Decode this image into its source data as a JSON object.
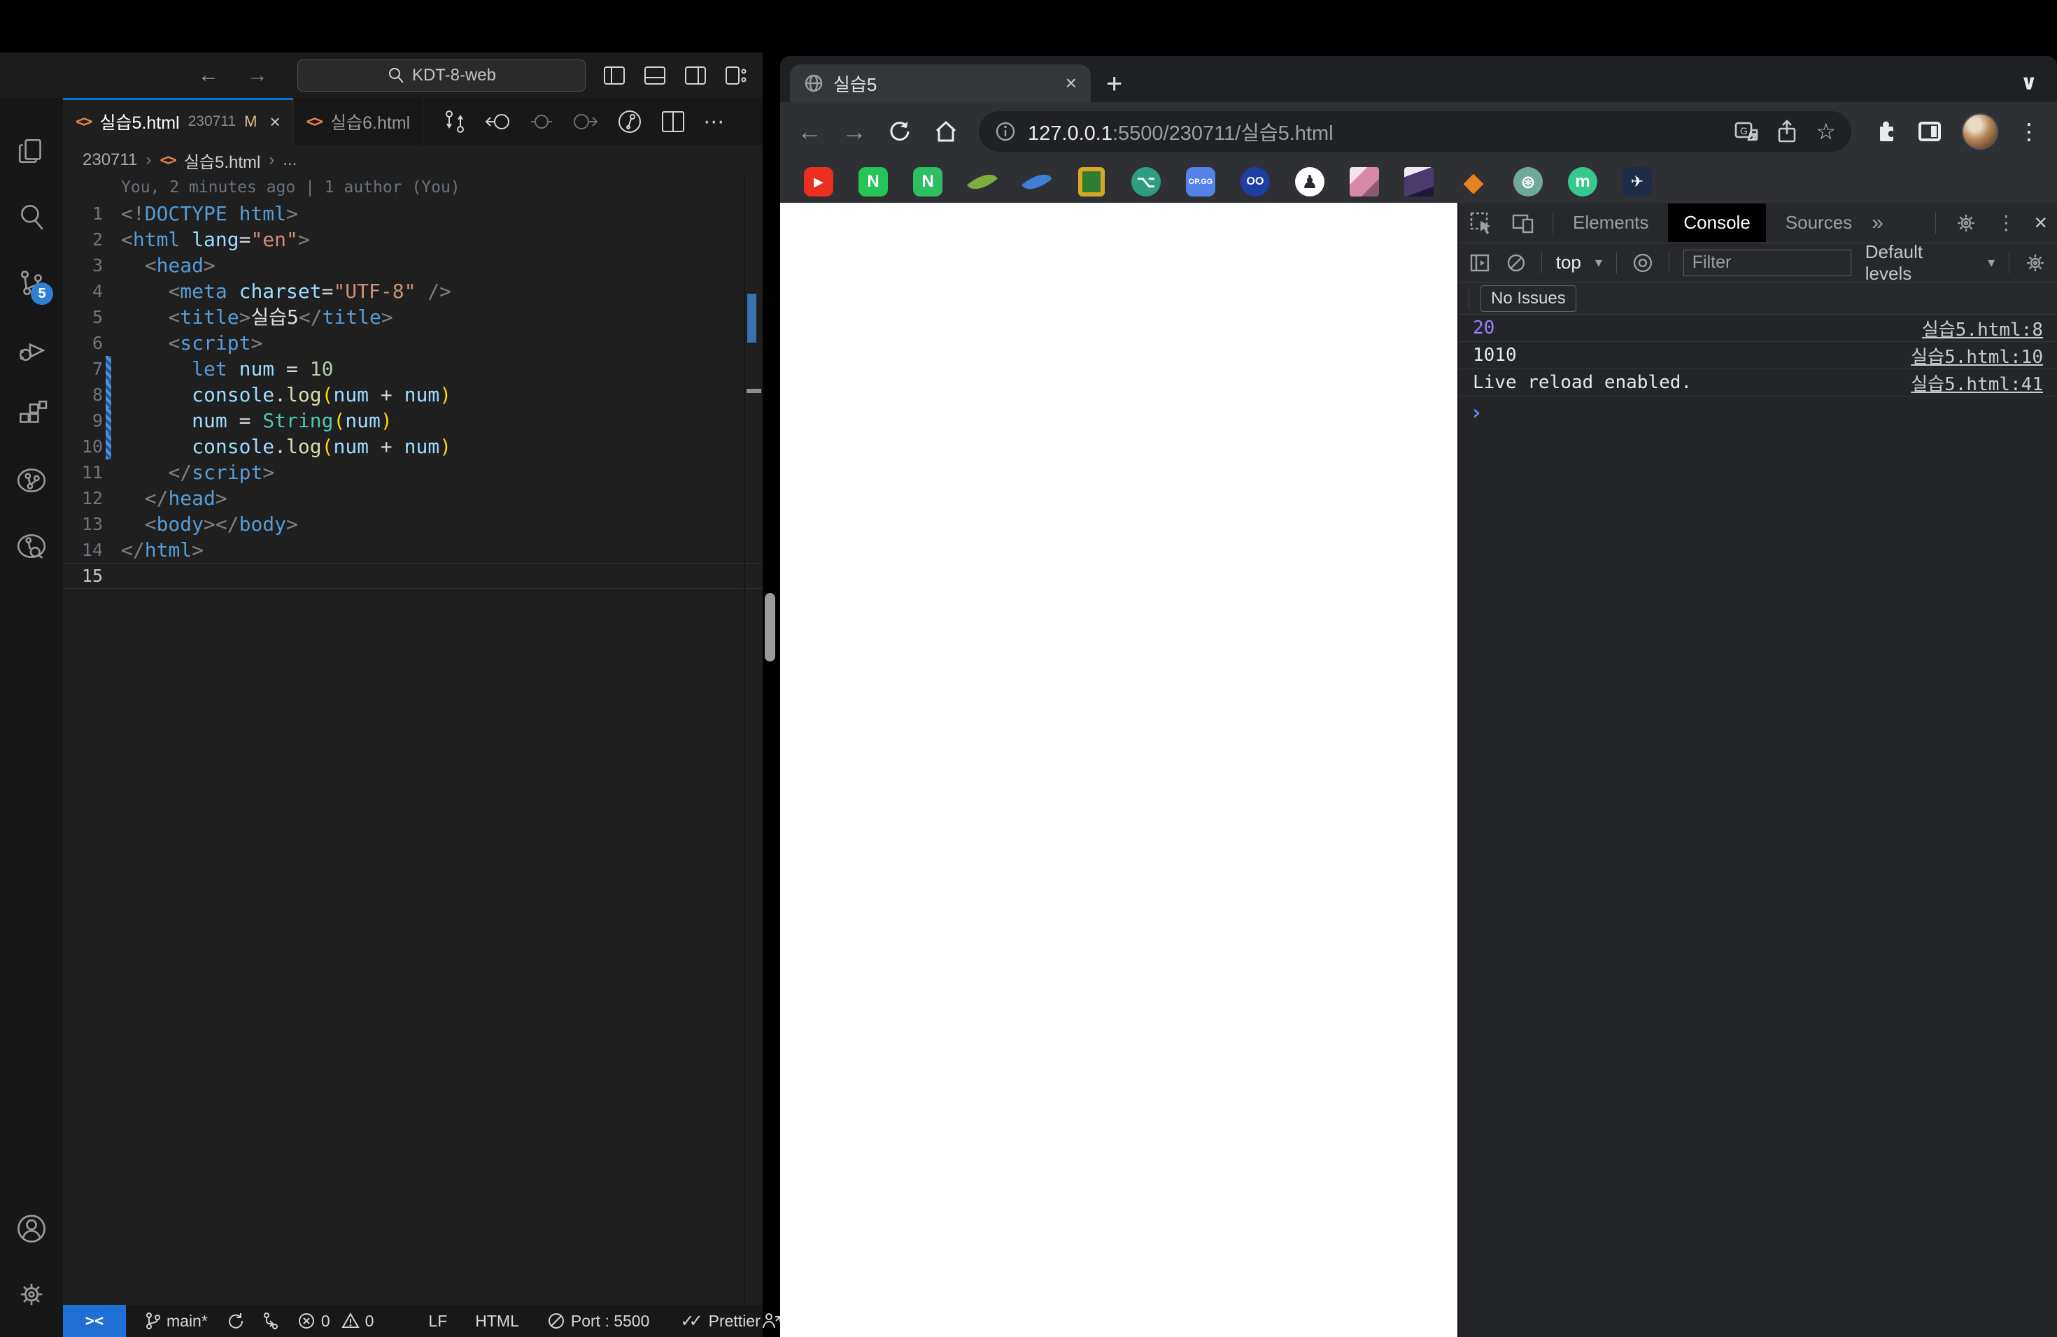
{
  "glyphs": {
    "back": "←",
    "forward": "→",
    "close": "×",
    "plus": "+",
    "more_h": "⋯",
    "more_v": "⋮",
    "chevron_down": "∨",
    "star": "☆",
    "breadcrumb_sep": "›",
    "tabs_overflow": "»",
    "caret_down": "▾",
    "checks": "✓✓",
    "remote": "><",
    "prompt": "›"
  },
  "vscode": {
    "titlebar": {
      "search_label": "KDT-8-web"
    },
    "tabs": [
      {
        "icon_label": "<>",
        "label": "실습5.html",
        "detail": "230711",
        "git_badge": "M"
      },
      {
        "icon_label": "<>",
        "label": "실습6.html"
      }
    ],
    "breadcrumb": {
      "folder": "230711",
      "icon_label": "<>",
      "file": "실습5.html",
      "more": "..."
    },
    "blame": "You, 2 minutes ago | 1 author (You)",
    "code": [
      {
        "n": 1,
        "mod": false,
        "seg": [
          [
            "p",
            "<!"
          ],
          [
            "k",
            "DOCTYPE html"
          ],
          [
            "p",
            ">"
          ]
        ]
      },
      {
        "n": 2,
        "mod": false,
        "seg": [
          [
            "p",
            "<"
          ],
          [
            "k",
            "html"
          ],
          [
            "a",
            " lang"
          ],
          [
            "o",
            "="
          ],
          [
            "s",
            "\"en\""
          ],
          [
            "p",
            ">"
          ]
        ]
      },
      {
        "n": 3,
        "mod": false,
        "seg": [
          [
            "t",
            "  "
          ],
          [
            "p",
            "<"
          ],
          [
            "k",
            "head"
          ],
          [
            "p",
            ">"
          ]
        ]
      },
      {
        "n": 4,
        "mod": false,
        "seg": [
          [
            "t",
            "    "
          ],
          [
            "p",
            "<"
          ],
          [
            "k",
            "meta"
          ],
          [
            "a",
            " charset"
          ],
          [
            "o",
            "="
          ],
          [
            "s",
            "\"UTF-8\""
          ],
          [
            "p",
            " />"
          ]
        ]
      },
      {
        "n": 5,
        "mod": false,
        "seg": [
          [
            "t",
            "    "
          ],
          [
            "p",
            "<"
          ],
          [
            "k",
            "title"
          ],
          [
            "p",
            ">"
          ],
          [
            "t",
            "실습5"
          ],
          [
            "p",
            "</"
          ],
          [
            "k",
            "title"
          ],
          [
            "p",
            ">"
          ]
        ]
      },
      {
        "n": 6,
        "mod": false,
        "seg": [
          [
            "t",
            "    "
          ],
          [
            "p",
            "<"
          ],
          [
            "k",
            "script"
          ],
          [
            "p",
            ">"
          ]
        ]
      },
      {
        "n": 7,
        "mod": true,
        "seg": [
          [
            "t",
            "      "
          ],
          [
            "kw",
            "let"
          ],
          [
            "v",
            " num"
          ],
          [
            "o",
            " = "
          ],
          [
            "num",
            "10"
          ]
        ]
      },
      {
        "n": 8,
        "mod": true,
        "seg": [
          [
            "t",
            "      "
          ],
          [
            "v",
            "console"
          ],
          [
            "o",
            "."
          ],
          [
            "fn",
            "log"
          ],
          [
            "b",
            "("
          ],
          [
            "v",
            "num"
          ],
          [
            "o",
            " + "
          ],
          [
            "v",
            "num"
          ],
          [
            "b",
            ")"
          ]
        ]
      },
      {
        "n": 9,
        "mod": true,
        "seg": [
          [
            "t",
            "      "
          ],
          [
            "v",
            "num"
          ],
          [
            "o",
            " = "
          ],
          [
            "cl",
            "String"
          ],
          [
            "b",
            "("
          ],
          [
            "v",
            "num"
          ],
          [
            "b",
            ")"
          ]
        ]
      },
      {
        "n": 10,
        "mod": true,
        "seg": [
          [
            "t",
            "      "
          ],
          [
            "v",
            "console"
          ],
          [
            "o",
            "."
          ],
          [
            "fn",
            "log"
          ],
          [
            "b",
            "("
          ],
          [
            "v",
            "num"
          ],
          [
            "o",
            " + "
          ],
          [
            "v",
            "num"
          ],
          [
            "b",
            ")"
          ]
        ]
      },
      {
        "n": 11,
        "mod": false,
        "seg": [
          [
            "t",
            "    "
          ],
          [
            "p",
            "</"
          ],
          [
            "k",
            "script"
          ],
          [
            "p",
            ">"
          ]
        ]
      },
      {
        "n": 12,
        "mod": false,
        "seg": [
          [
            "t",
            "  "
          ],
          [
            "p",
            "</"
          ],
          [
            "k",
            "head"
          ],
          [
            "p",
            ">"
          ]
        ]
      },
      {
        "n": 13,
        "mod": false,
        "seg": [
          [
            "t",
            "  "
          ],
          [
            "p",
            "<"
          ],
          [
            "k",
            "body"
          ],
          [
            "p",
            ">"
          ],
          [
            "p",
            "</"
          ],
          [
            "k",
            "body"
          ],
          [
            "p",
            ">"
          ]
        ]
      },
      {
        "n": 14,
        "mod": false,
        "seg": [
          [
            "p",
            "</"
          ],
          [
            "k",
            "html"
          ],
          [
            "p",
            ">"
          ]
        ]
      },
      {
        "n": 15,
        "mod": false,
        "current": true,
        "seg": []
      }
    ],
    "status": {
      "remote_glyph": "><",
      "branch": "main*",
      "errors": "0",
      "warnings": "0",
      "eol": "LF",
      "lang": "HTML",
      "port_label": "Port : 5500",
      "formatter": "Prettier"
    }
  },
  "chrome": {
    "tab_title": "실습5",
    "url_host": "127.0.0.1",
    "url_rest": ":5500/230711/실습5.html",
    "bookmarks": [
      {
        "name": "youtube",
        "shape": "rounded",
        "bg": "#ea2f1f",
        "glyph": "▶",
        "fg": "#ffffff",
        "size": 18
      },
      {
        "name": "naver-1",
        "shape": "rounded",
        "bg": "#27c458",
        "glyph": "N",
        "fg": "#ffffff",
        "size": 24
      },
      {
        "name": "naver-2",
        "shape": "rounded",
        "bg": "#2fbf63",
        "glyph": "N",
        "fg": "#ffffff",
        "size": 24
      },
      {
        "name": "leaf",
        "shape": "leaf",
        "bg": "#7fae3f",
        "glyph": "",
        "fg": "#ffffff",
        "size": 0
      },
      {
        "name": "feather",
        "shape": "feather",
        "bg": "#3f7fd6",
        "glyph": "",
        "fg": "#ffffff",
        "size": 0
      },
      {
        "name": "gold-frame",
        "shape": "frame",
        "bg": "#d9a524",
        "glyph": "",
        "fg": "#2e7d32",
        "size": 0
      },
      {
        "name": "branch-circle",
        "shape": "circle",
        "bg": "#2e9e83",
        "glyph": "⌥",
        "fg": "#ffffff",
        "size": 24
      },
      {
        "name": "opgg",
        "shape": "rounded",
        "bg": "#5383e8",
        "glyph": "OP.GG",
        "fg": "#ffffff",
        "size": 11
      },
      {
        "name": "binoculars",
        "shape": "circle",
        "bg": "#1d3fa3",
        "glyph": "OO",
        "fg": "#ffffff",
        "size": 16
      },
      {
        "name": "github",
        "shape": "circle",
        "bg": "#ffffff",
        "glyph": "♟",
        "fg": "#24292f",
        "size": 26
      },
      {
        "name": "photo-pink",
        "shape": "photo1",
        "bg": "#d89bb0",
        "glyph": "",
        "fg": "#ffffff",
        "size": 0
      },
      {
        "name": "photo-purple",
        "shape": "photo2",
        "bg": "#3c2f59",
        "glyph": "",
        "fg": "#ffffff",
        "size": 0
      },
      {
        "name": "orange-gem",
        "shape": "plain",
        "bg": "transparent",
        "glyph": "◆",
        "fg": "#e8821e",
        "size": 38
      },
      {
        "name": "spiral",
        "shape": "circle",
        "bg": "#6fa99c",
        "glyph": "⊛",
        "fg": "#ffffff",
        "size": 26
      },
      {
        "name": "m-circle",
        "shape": "circle",
        "bg": "#35c98e",
        "glyph": "m",
        "fg": "#ffffff",
        "size": 24
      },
      {
        "name": "bird",
        "shape": "rounded",
        "bg": "#1d2b45",
        "glyph": "✈",
        "fg": "#ffffff",
        "size": 22
      }
    ],
    "devtools": {
      "tabs": [
        "Elements",
        "Console",
        "Sources"
      ],
      "active_tab": "Console",
      "context": "top",
      "filter_placeholder": "Filter",
      "levels_label": "Default levels",
      "issues_label": "No Issues",
      "messages": [
        {
          "text": "20",
          "type": "number",
          "source": "실습5.html:8"
        },
        {
          "text": "1010",
          "type": "log",
          "source": "실습5.html:10"
        },
        {
          "text": "Live reload enabled.",
          "type": "log",
          "source": "실습5.html:41"
        }
      ]
    }
  }
}
